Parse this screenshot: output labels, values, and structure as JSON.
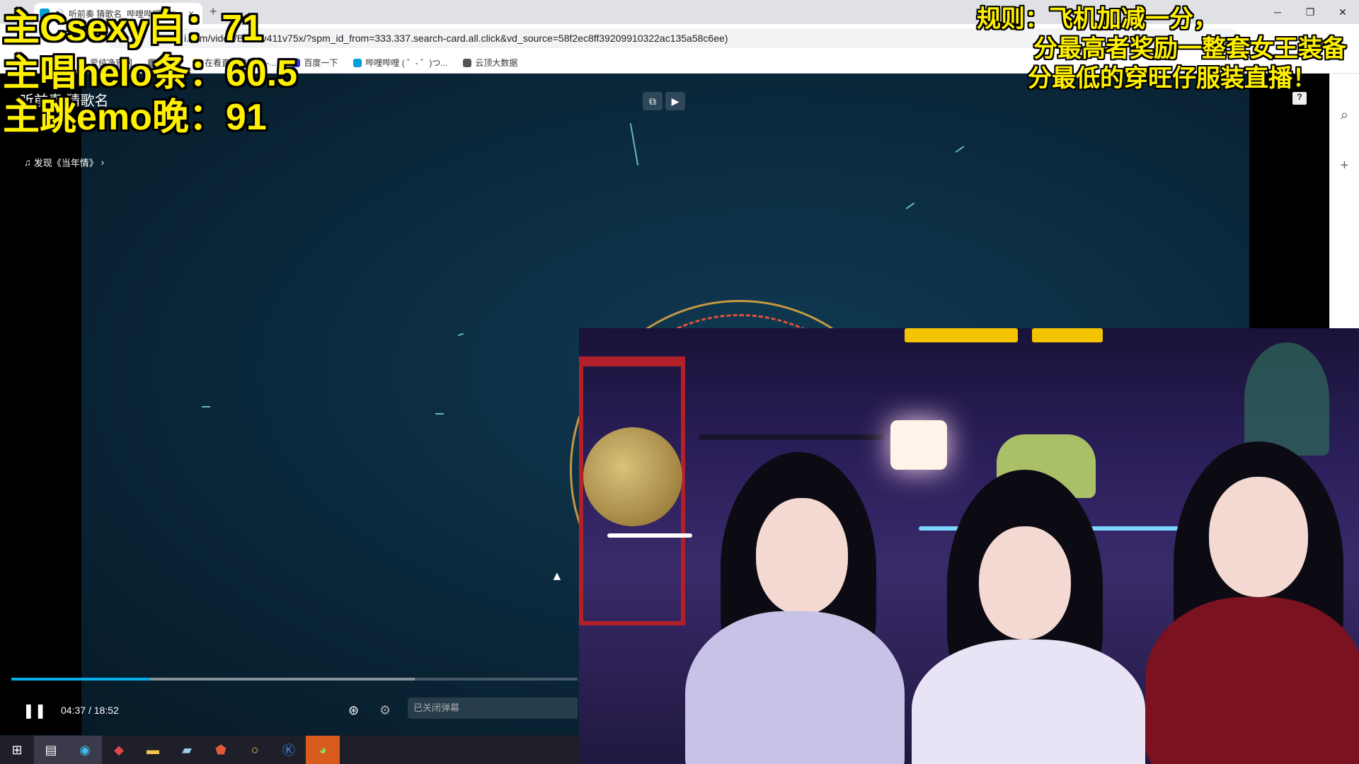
{
  "browser": {
    "tab_title": "听前奏 猜歌名_哔哩哔哩_bili",
    "url": "i.com/video/BV1Yv411v75x/?spm_id_from=333.337.search-card.all.click&vd_source=58f2ec8ff39209910322ac135a58c6ee)",
    "bookmarks": [
      {
        "label": "爱纯净官网",
        "color": "#2bb24c"
      },
      {
        "label": "关注",
        "color": "#888888"
      },
      {
        "label": "在看直播排行榜 -...",
        "color": "#f2b400"
      },
      {
        "label": "百度一下",
        "color": "#2932e1"
      },
      {
        "label": "哔哩哔哩 ( ゜- ゜)つ...",
        "color": "#00a1d6"
      },
      {
        "label": "云顶大数据",
        "color": "#555555"
      }
    ]
  },
  "player": {
    "video_title": "听前奏 猜歌名",
    "music_link": "发现《当年情》",
    "time_current": "04:37",
    "time_separator": "/",
    "time_total": "18:52",
    "danmaku_placeholder": "已关闭弹幕",
    "progress_played_fraction": 0.245,
    "help_label": "?"
  },
  "overlay": {
    "scores": [
      {
        "text": "主Csexy白：71"
      },
      {
        "text": "主唱helo条：60.5"
      },
      {
        "text": "主跳emo晚：91"
      }
    ],
    "rules": [
      "规则：飞机加减一分，",
      "分最高者奖励一整套女王装备",
      "分最低的穿旺仔服装直播！"
    ]
  },
  "taskbar": {
    "icons": [
      "windows-icon",
      "server-manager-icon",
      "edge-icon",
      "app-red-icon",
      "folder-icon",
      "notes-icon",
      "shield-app-icon",
      "circle-app-icon",
      "k-app-icon",
      "wechat-icon"
    ]
  },
  "colors": {
    "accent_progress": "#00aeec",
    "overlay_text": "#fff000",
    "ring_gold": "#d9a441",
    "ring_red": "#e3513a"
  }
}
